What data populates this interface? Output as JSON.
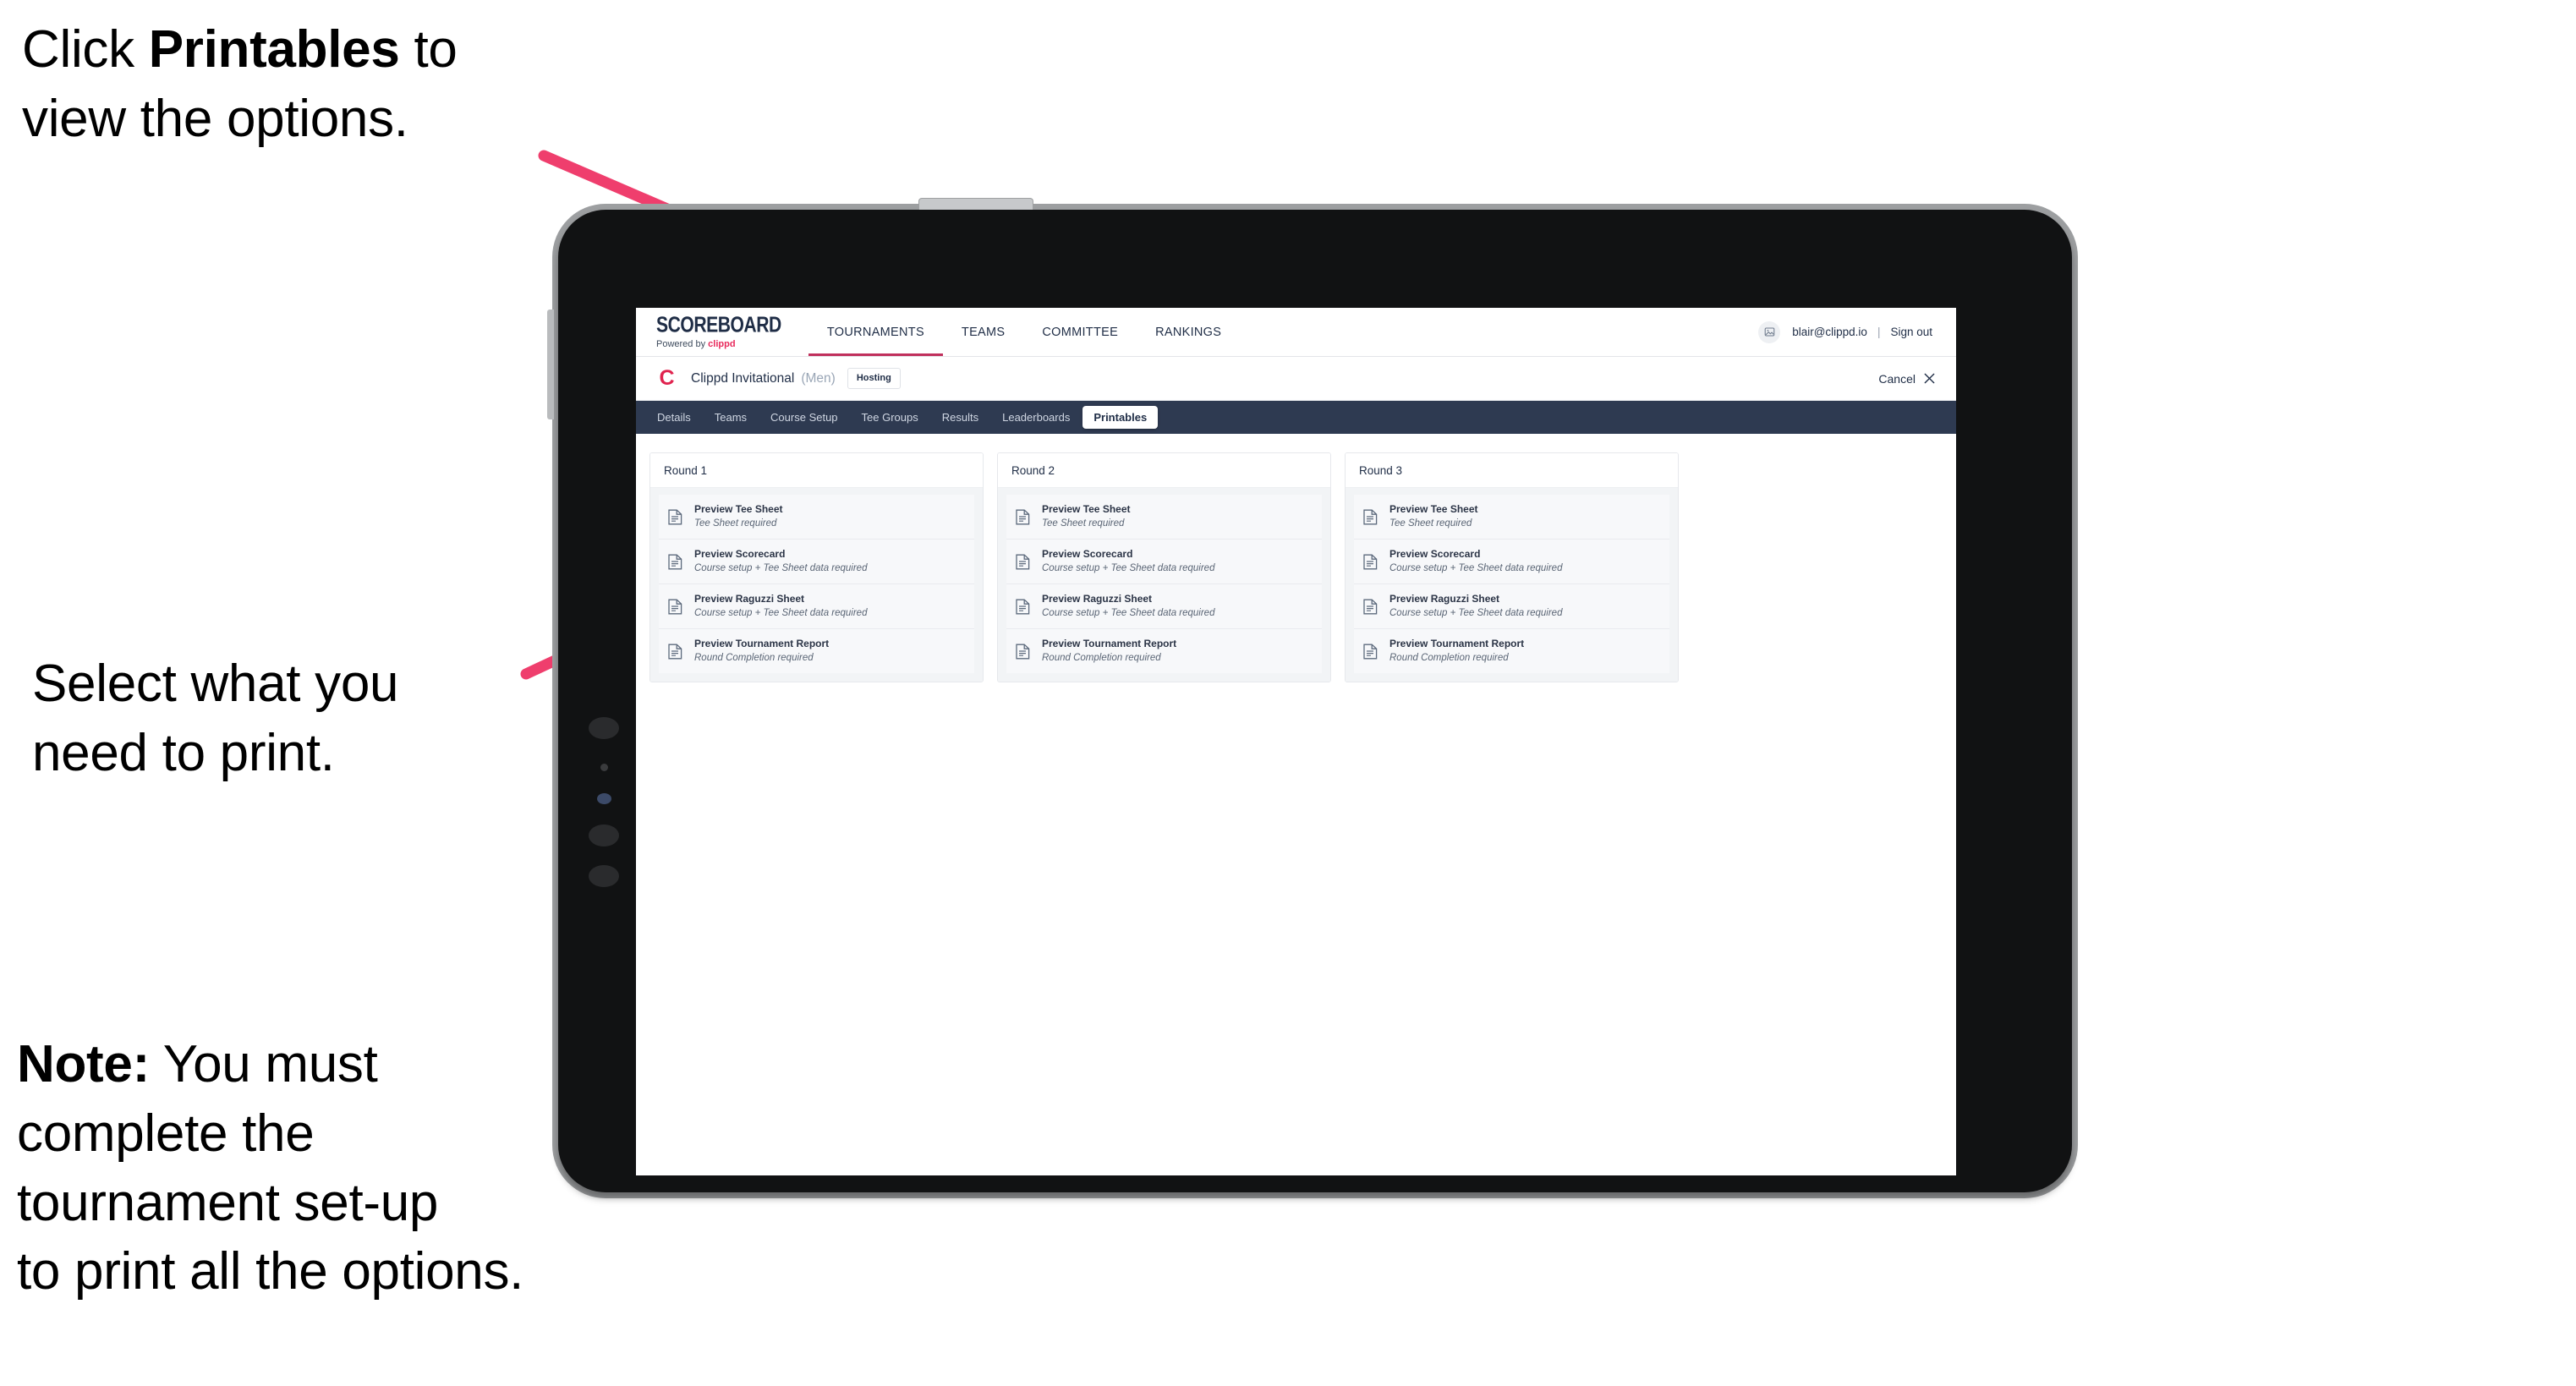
{
  "annotations": {
    "callout_1": {
      "prefix": "Click ",
      "bold": "Printables",
      "suffix": " to\nview the options."
    },
    "callout_2": {
      "text": "Select what you\n need to print."
    },
    "callout_3": {
      "bold": "Note:",
      "text": " You must\ncomplete the\ntournament set-up\nto print all the options."
    }
  },
  "app": {
    "brand": {
      "word": "SCOREBOARD",
      "powered_by": "Powered by ",
      "powered_brand": "clippd"
    },
    "nav": [
      {
        "label": "TOURNAMENTS",
        "active": true
      },
      {
        "label": "TEAMS",
        "active": false
      },
      {
        "label": "COMMITTEE",
        "active": false
      },
      {
        "label": "RANKINGS",
        "active": false
      }
    ],
    "account": {
      "avatar_icon": "user-image-icon",
      "email": "blair@clippd.io",
      "separator": "|",
      "sign_out": "Sign out"
    },
    "tournament": {
      "logo_letter": "C",
      "name": "Clippd Invitational",
      "gender": "(Men)",
      "status_badge": "Hosting",
      "cancel_label": "Cancel",
      "cancel_icon": "close-icon"
    },
    "tabs": [
      {
        "label": "Details",
        "selected": false
      },
      {
        "label": "Teams",
        "selected": false
      },
      {
        "label": "Course Setup",
        "selected": false
      },
      {
        "label": "Tee Groups",
        "selected": false
      },
      {
        "label": "Results",
        "selected": false
      },
      {
        "label": "Leaderboards",
        "selected": false
      },
      {
        "label": "Printables",
        "selected": true
      }
    ],
    "rounds": [
      {
        "title": "Round 1",
        "items": [
          {
            "icon": "document-icon",
            "title": "Preview Tee Sheet",
            "sub": "Tee Sheet required"
          },
          {
            "icon": "document-icon",
            "title": "Preview Scorecard",
            "sub": "Course setup + Tee Sheet data required"
          },
          {
            "icon": "document-icon",
            "title": "Preview Raguzzi Sheet",
            "sub": "Course setup + Tee Sheet data required"
          },
          {
            "icon": "document-icon",
            "title": "Preview Tournament Report",
            "sub": "Round Completion required"
          }
        ]
      },
      {
        "title": "Round 2",
        "items": [
          {
            "icon": "document-icon",
            "title": "Preview Tee Sheet",
            "sub": "Tee Sheet required"
          },
          {
            "icon": "document-icon",
            "title": "Preview Scorecard",
            "sub": "Course setup + Tee Sheet data required"
          },
          {
            "icon": "document-icon",
            "title": "Preview Raguzzi Sheet",
            "sub": "Course setup + Tee Sheet data required"
          },
          {
            "icon": "document-icon",
            "title": "Preview Tournament Report",
            "sub": "Round Completion required"
          }
        ]
      },
      {
        "title": "Round 3",
        "items": [
          {
            "icon": "document-icon",
            "title": "Preview Tee Sheet",
            "sub": "Tee Sheet required"
          },
          {
            "icon": "document-icon",
            "title": "Preview Scorecard",
            "sub": "Course setup + Tee Sheet data required"
          },
          {
            "icon": "document-icon",
            "title": "Preview Raguzzi Sheet",
            "sub": "Course setup + Tee Sheet data required"
          },
          {
            "icon": "document-icon",
            "title": "Preview Tournament Report",
            "sub": "Round Completion required"
          }
        ]
      }
    ]
  },
  "colors": {
    "accent_pink": "#ef3e6d",
    "brand_red": "#e0244f",
    "tabbar_navy": "#2e3a51",
    "text_navy": "#1f2d46",
    "card_grey": "#f2f4f6"
  }
}
